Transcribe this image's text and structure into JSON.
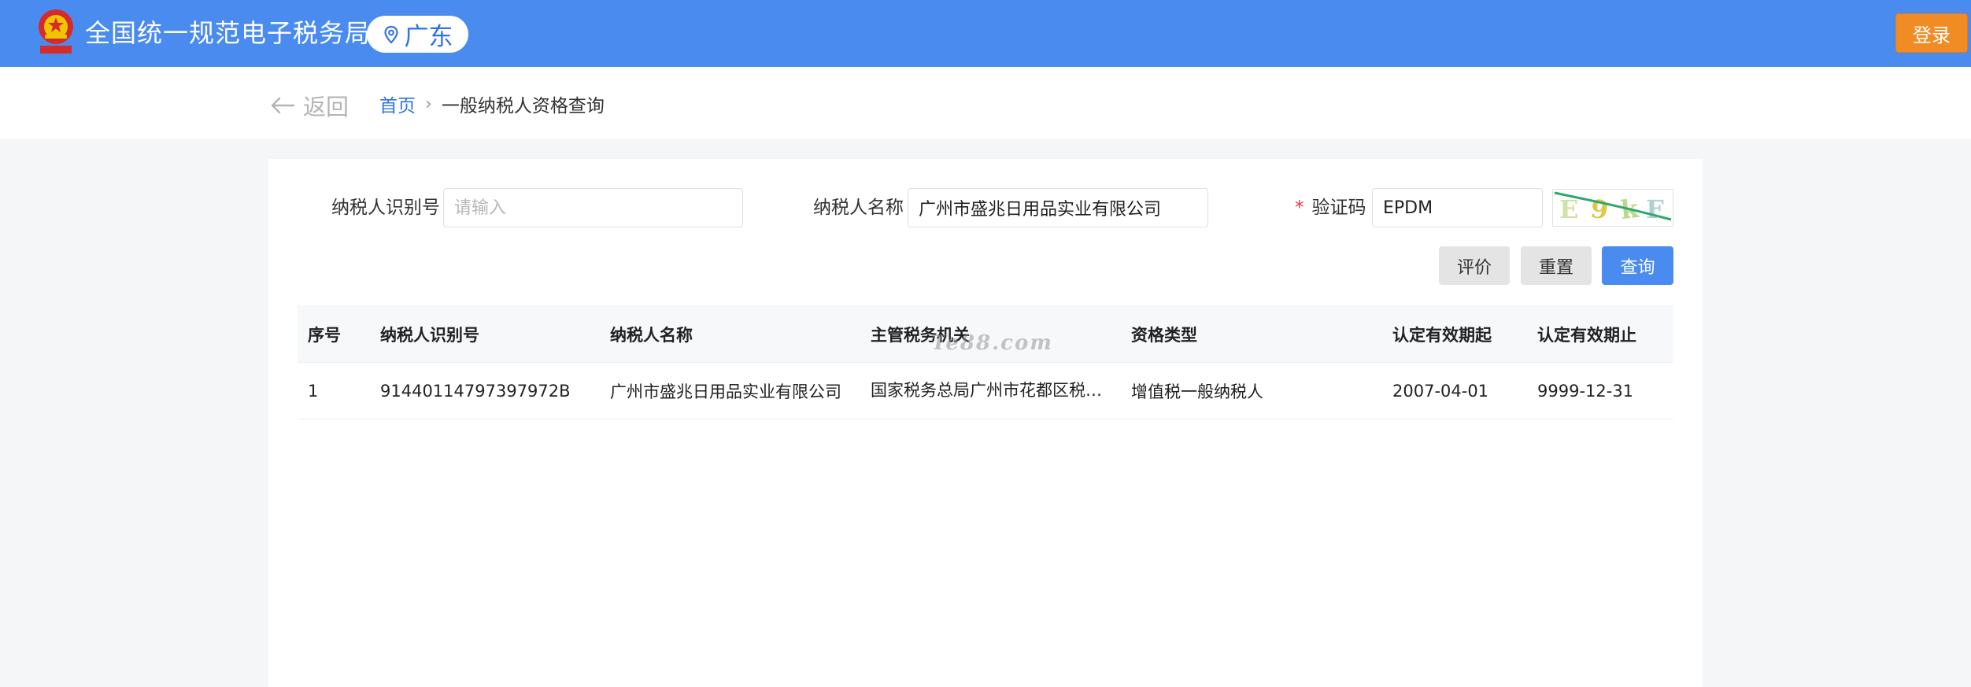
{
  "header": {
    "title": "全国统一规范电子税务局",
    "region": "广东",
    "login_label": "登录"
  },
  "nav": {
    "back_label": "返回",
    "breadcrumb_home": "首页",
    "breadcrumb_current": "一般纳税人资格查询"
  },
  "form": {
    "taxpayer_id_label": "纳税人识别号",
    "taxpayer_id_placeholder": "请输入",
    "taxpayer_id_value": "",
    "taxpayer_name_label": "纳税人名称",
    "taxpayer_name_value": "广州市盛兆日用品实业有限公司",
    "captcha_required_mark": "*",
    "captcha_label": "验证码",
    "captcha_value": "EPDM",
    "captcha_image_text": "E9kF"
  },
  "buttons": {
    "rate": "评价",
    "reset": "重置",
    "query": "查询"
  },
  "table": {
    "columns": [
      "序号",
      "纳税人识别号",
      "纳税人名称",
      "主管税务机关",
      "资格类型",
      "认定有效期起",
      "认定有效期止"
    ],
    "rows": [
      [
        "1",
        "91440114797397972B",
        "广州市盛兆日用品实业有限公司",
        "国家税务总局广州市花都区税务局",
        "增值税一般纳税人",
        "2007-04-01",
        "9999-12-31"
      ]
    ]
  },
  "watermark": "Te88.com",
  "colors": {
    "header_bg": "#4a8bf0",
    "login_bg": "#f08c23",
    "primary": "#2f73e6",
    "required": "#e03a3a"
  }
}
